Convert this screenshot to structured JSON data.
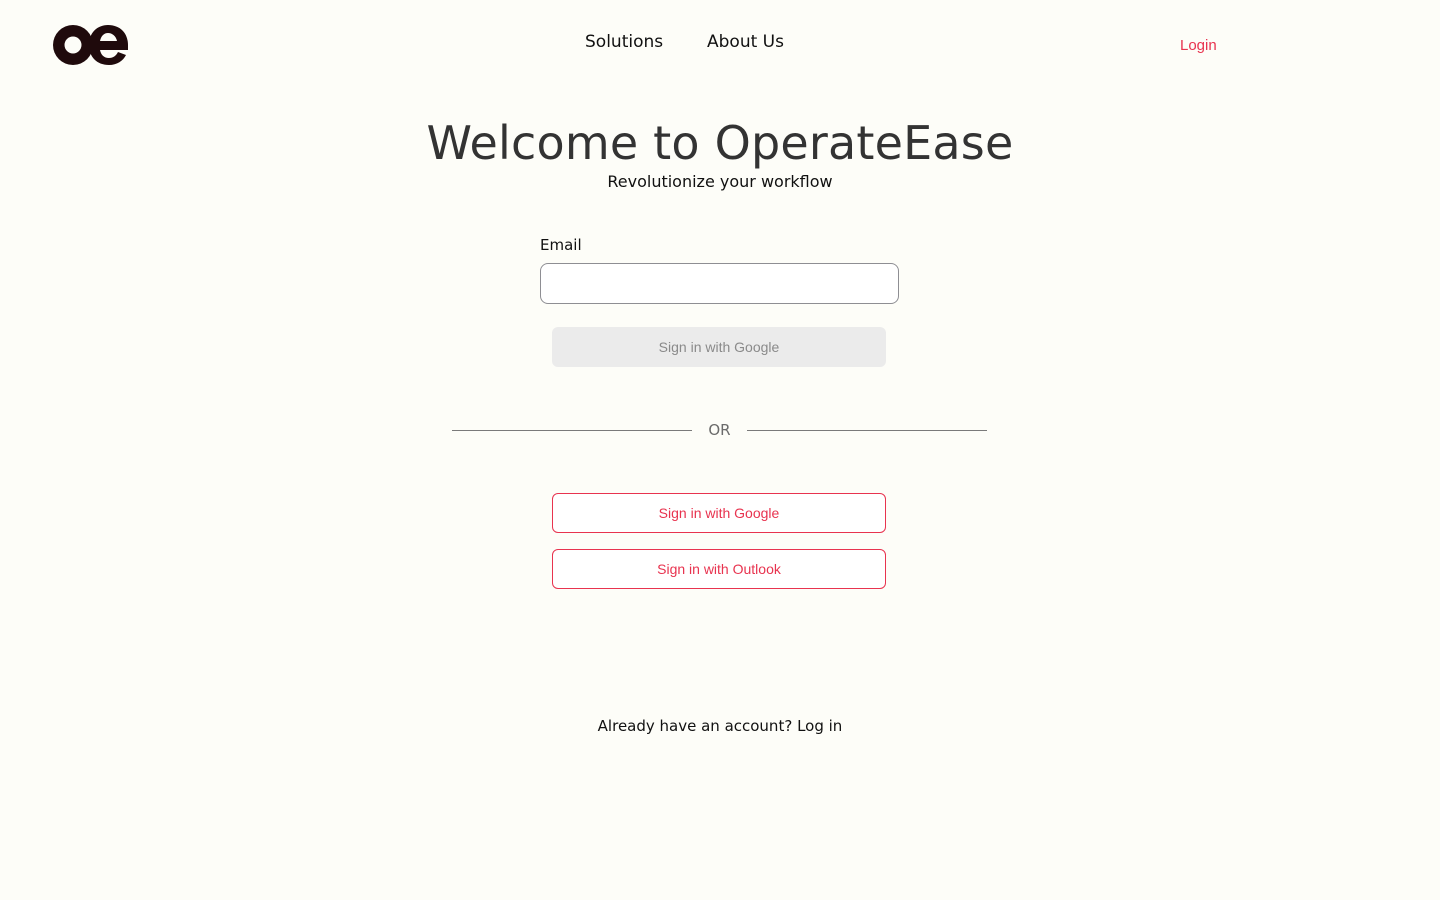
{
  "header": {
    "logo_text": "oe",
    "nav": {
      "solutions": "Solutions",
      "about": "About Us"
    },
    "login": "Login"
  },
  "hero": {
    "title": "Welcome to OperateEase",
    "subtitle": "Revolutionize your workflow"
  },
  "form": {
    "email_label": "Email",
    "email_value": "",
    "email_placeholder": "",
    "email_submit": "Sign in with Google"
  },
  "divider": {
    "text": "OR"
  },
  "sso": {
    "google": "Sign in with Google",
    "outlook": "Sign in with Outlook"
  },
  "footer": {
    "prompt": "Already have an account?",
    "link": "Log in"
  },
  "colors": {
    "accent": "#e8334f",
    "background": "#fdfdf8",
    "logo": "#1f0a0c"
  }
}
